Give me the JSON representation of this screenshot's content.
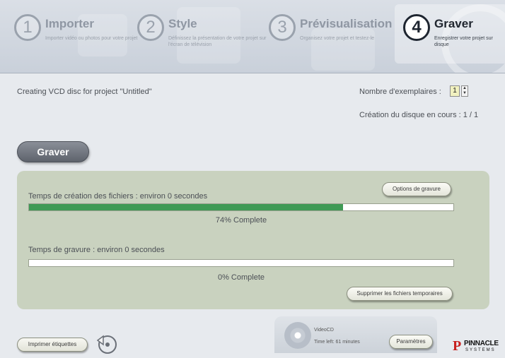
{
  "steps": [
    {
      "number": "1",
      "title": "Importer",
      "desc": "Importer vidéo ou photos pour votre projet"
    },
    {
      "number": "2",
      "title": "Style",
      "desc": "Définissez la présentation de votre projet sur l'écran de télévision"
    },
    {
      "number": "3",
      "title": "Prévisualisation",
      "desc": "Organisez votre projet et testez-le"
    },
    {
      "number": "4",
      "title": "Graver",
      "desc": "Enregistrer votre projet sur disque"
    }
  ],
  "project_line": "Creating VCD disc for project \"Untitled\"",
  "copies": {
    "label": "Nombre d'exemplaires :",
    "value": "1",
    "up": "▲",
    "down": "▼"
  },
  "creation_status": "Création du disque en cours : 1 / 1",
  "burn_button": "Graver",
  "options_button": "Options de gravure",
  "file_creation": {
    "label": "Temps de création des fichiers : environ 0 secondes",
    "progress": 0.74,
    "percent_text": "74% Complete"
  },
  "burning": {
    "label": "Temps de gravure : environ 0 secondes",
    "progress": 0.0,
    "percent_text": "0% Complete"
  },
  "delete_temp_button": "Supprimer les fichiers temporaires",
  "print_labels_button": "Imprimer étiquettes",
  "disc": {
    "type": "VideoCD",
    "time_left": "Time left: 61 minutes",
    "settings_button": "Paramètres"
  },
  "logo": {
    "name": "PINNACLE",
    "sub": "SYSTEMS"
  },
  "colors": {
    "progress_fill": "#3f9a55",
    "panel": "#c9d2bf",
    "active_step": "#1e2530",
    "logo_red": "#c8201e"
  }
}
